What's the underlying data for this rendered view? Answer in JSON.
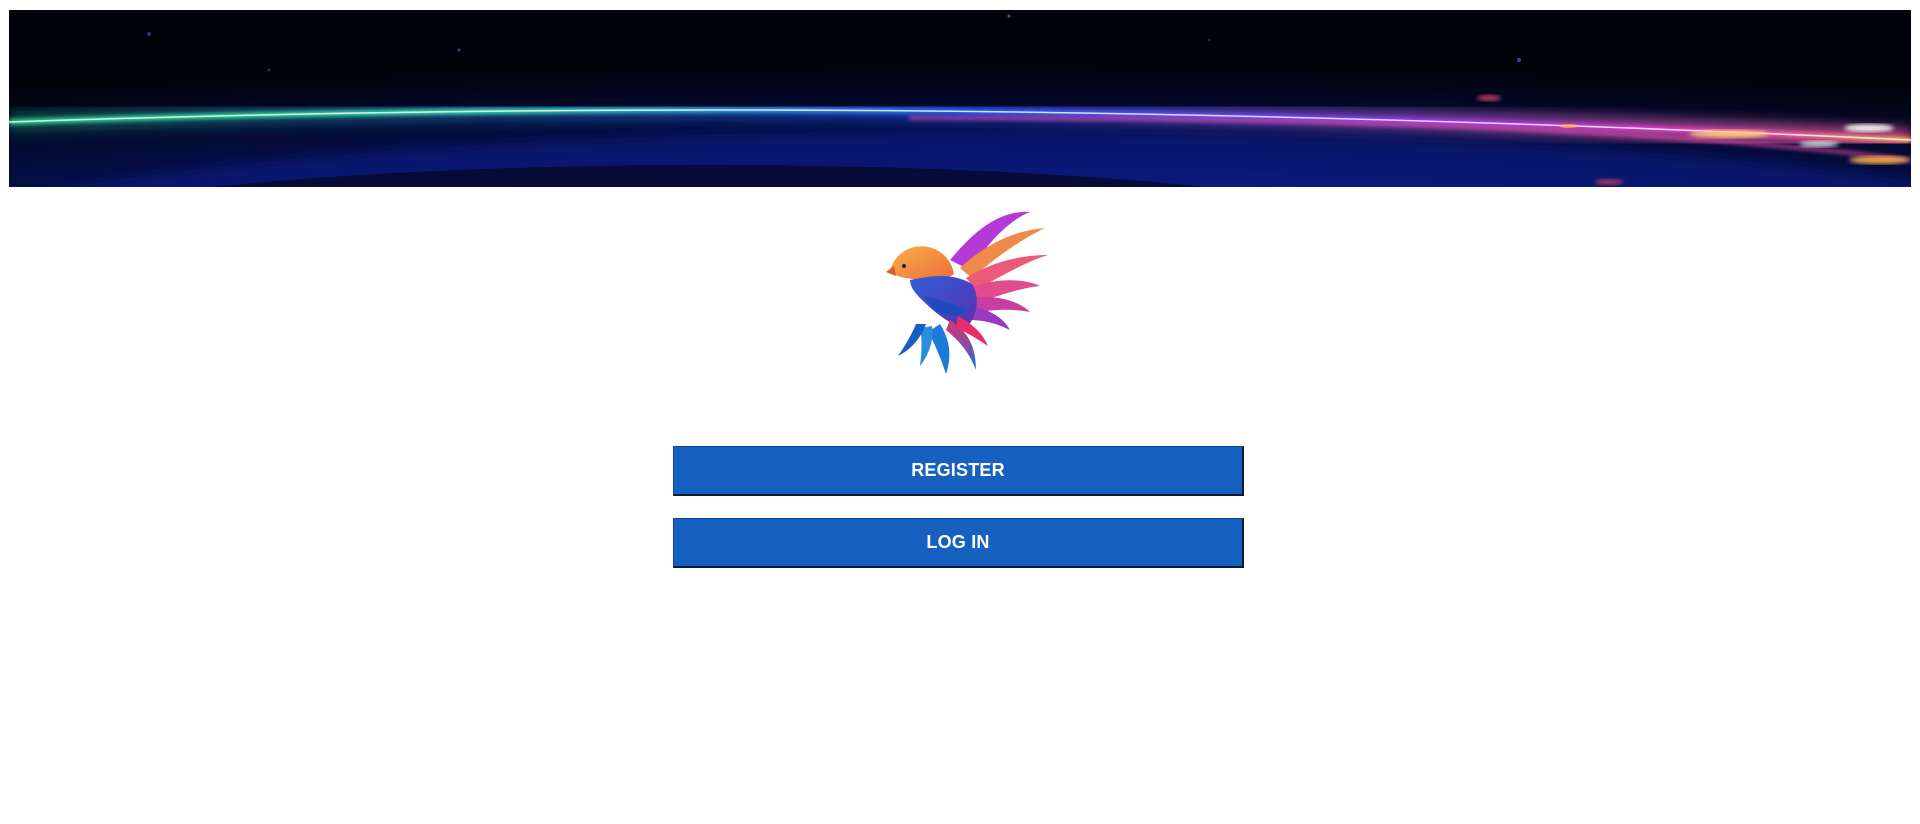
{
  "banner": {
    "icon": "space-light-streak-banner"
  },
  "logo": {
    "icon": "phoenix-bird-icon"
  },
  "actions": {
    "register_label": "REGISTER",
    "login_label": "LOG IN"
  },
  "colors": {
    "button_bg": "#1660c0",
    "button_text": "#ffffff",
    "page_bg": "#ffffff"
  }
}
